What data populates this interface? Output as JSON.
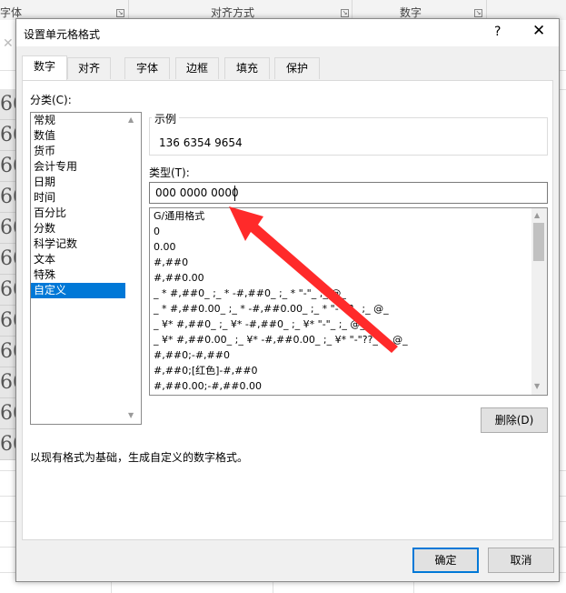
{
  "ribbon": {
    "groups": [
      "字体",
      "对齐方式",
      "数字"
    ]
  },
  "sheet": {
    "cells": [
      "66",
      "66",
      "66",
      "66",
      "66",
      "66",
      "66",
      "66",
      "66",
      "66",
      "66",
      "66"
    ]
  },
  "dialog": {
    "title": "设置单元格格式",
    "help": "?",
    "close": "✕",
    "tabs": [
      "数字",
      "对齐",
      "字体",
      "边框",
      "填充",
      "保护"
    ],
    "active_tab": "数字",
    "category_label": "分类(C):",
    "categories": [
      "常规",
      "数值",
      "货币",
      "会计专用",
      "日期",
      "时间",
      "百分比",
      "分数",
      "科学记数",
      "文本",
      "特殊",
      "自定义"
    ],
    "selected_category": "自定义",
    "sample_label": "示例",
    "sample_value": "136 6354 9654",
    "type_label": "类型(T):",
    "type_value": "000 0000 0000",
    "formats": [
      "G/通用格式",
      "0",
      "0.00",
      "#,##0",
      "#,##0.00",
      "_ * #,##0_ ;_ * -#,##0_ ;_ * \"-\"_ ;_ @_",
      "_ * #,##0.00_ ;_ * -#,##0.00_ ;_ * \"-\"??_ ;_ @_",
      "_ ¥* #,##0_ ;_ ¥* -#,##0_ ;_ ¥* \"-\"_ ;_ @_",
      "_ ¥* #,##0.00_ ;_ ¥* -#,##0.00_ ;_ ¥* \"-\"??_ ;_ @_",
      "#,##0;-#,##0",
      "#,##0;[红色]-#,##0",
      "#,##0.00;-#,##0.00"
    ],
    "delete_button": "删除(D)",
    "description": "以现有格式为基础，生成自定义的数字格式。",
    "ok_button": "确定",
    "cancel_button": "取消"
  },
  "colors": {
    "accent": "#0078d7",
    "arrow": "#ff2a2a"
  }
}
